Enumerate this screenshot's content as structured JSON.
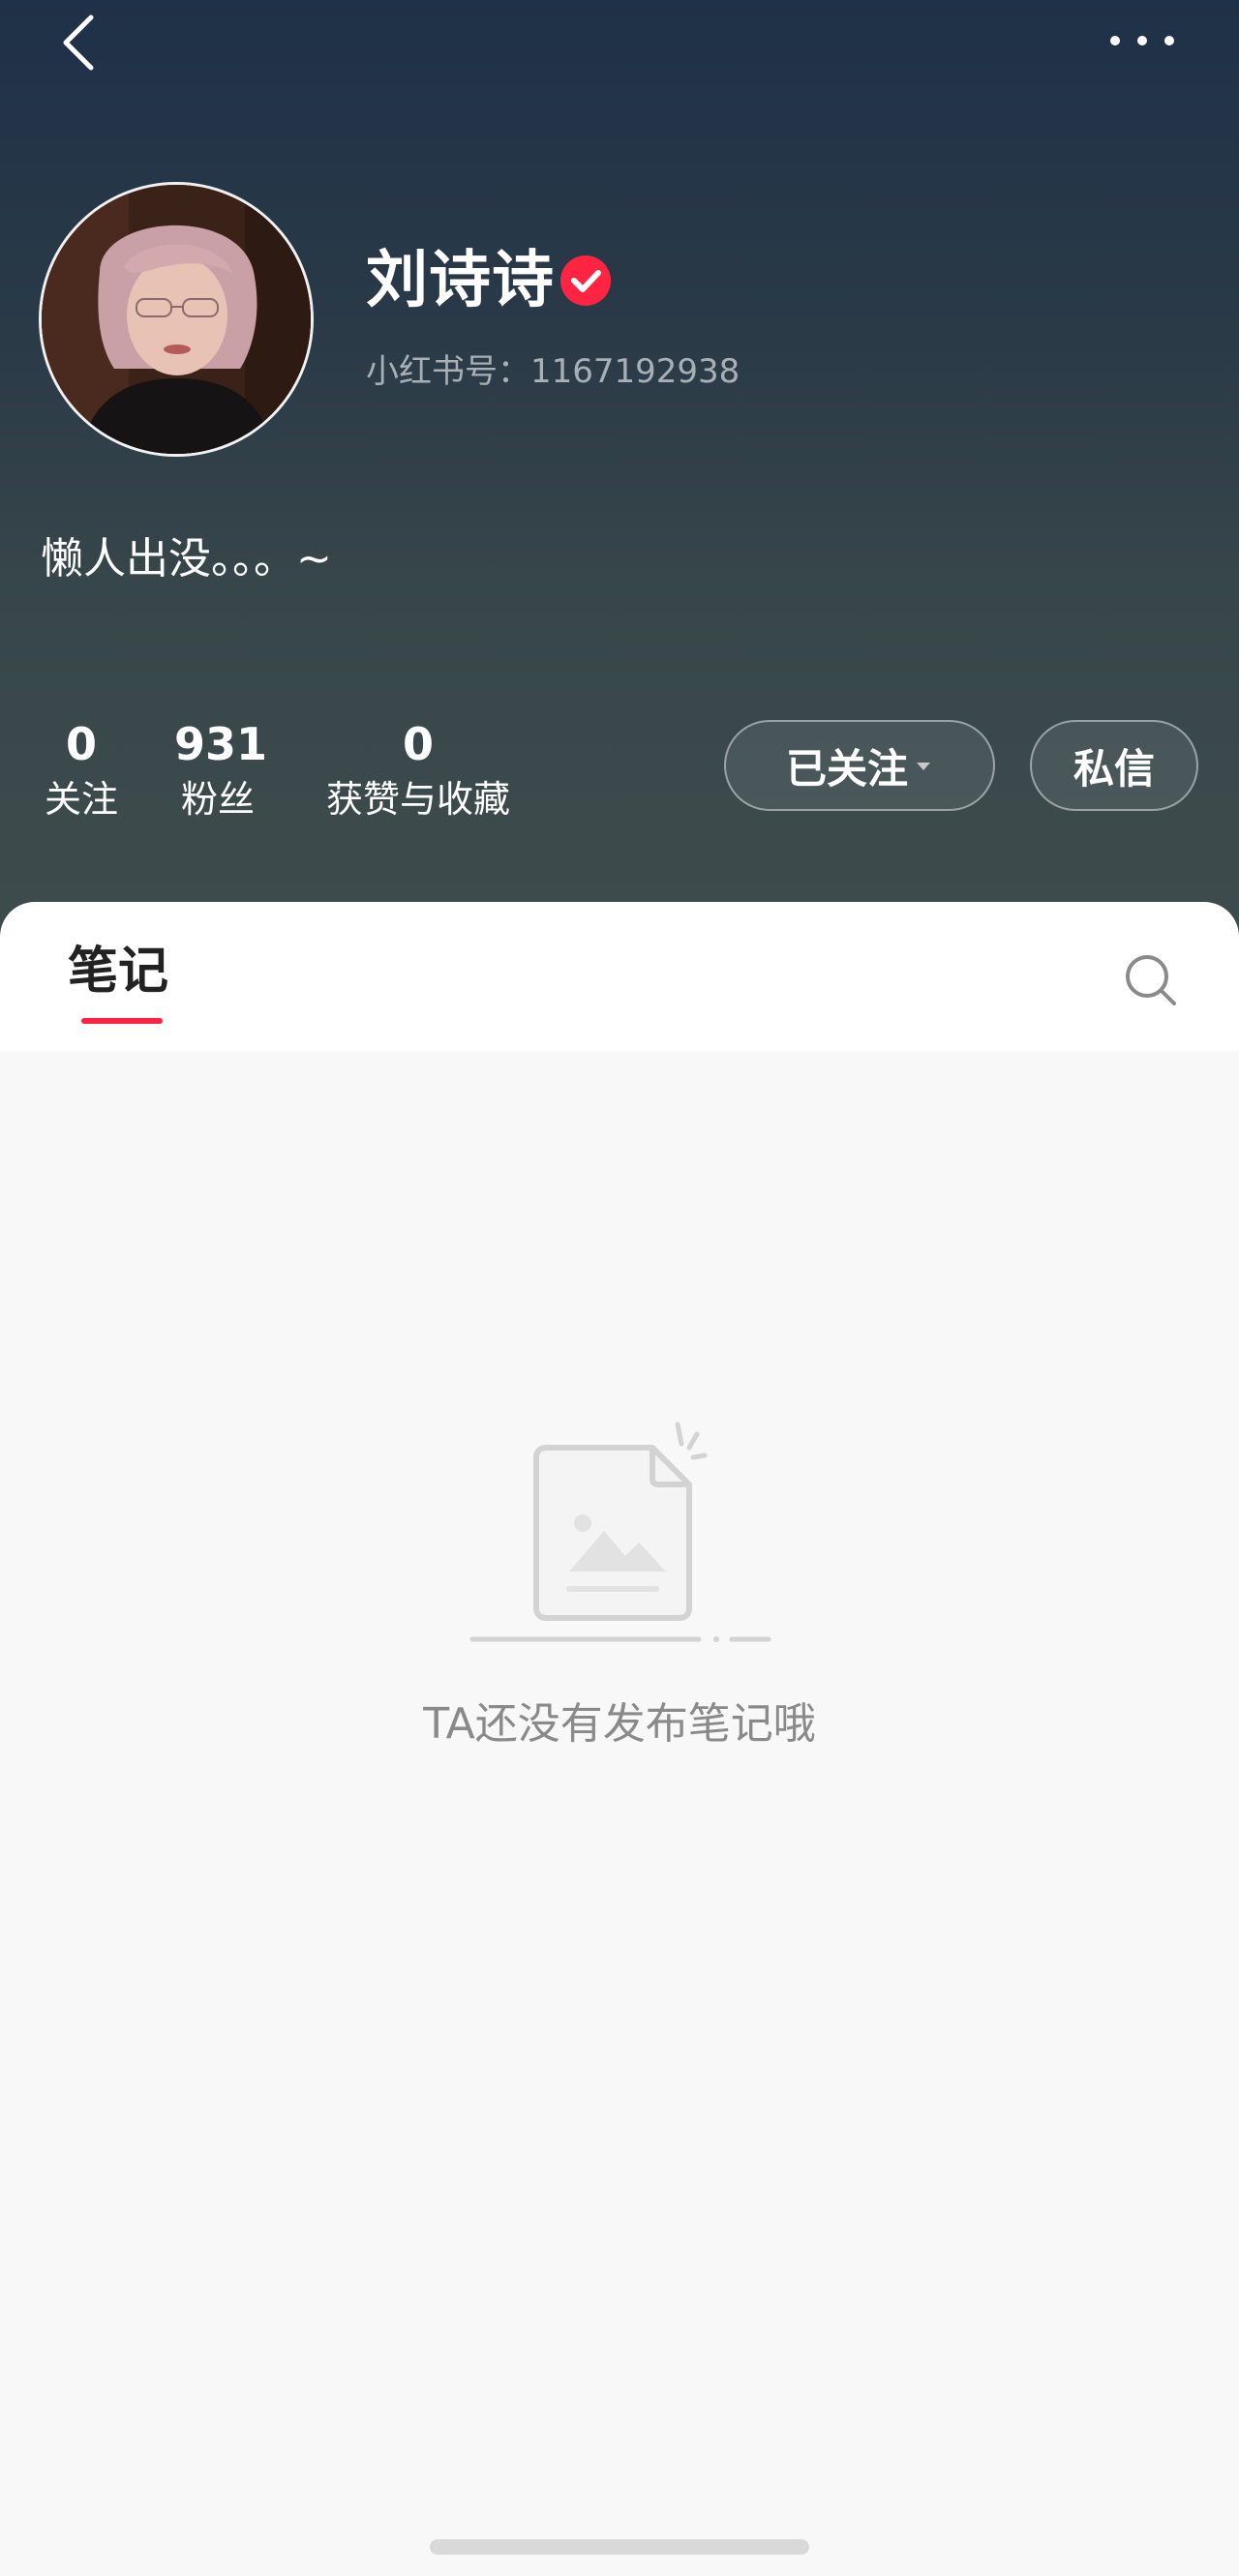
{
  "header": {
    "back_icon": "chevron-left-icon",
    "more_icon": "more-dots-icon"
  },
  "profile": {
    "name": "刘诗诗",
    "verified_icon": "verified-badge-icon",
    "user_id": "小红书号：1167192938",
    "bio": "懒人出没。。。~"
  },
  "stats": [
    {
      "value": "0",
      "label": "关注"
    },
    {
      "value": "931",
      "label": "粉丝"
    },
    {
      "value": "0",
      "label": "获赞与收藏"
    }
  ],
  "actions": {
    "follow_label": "已关注",
    "message_label": "私信"
  },
  "tabs": {
    "notes_label": "笔记",
    "search_icon": "search-icon"
  },
  "empty_state": {
    "icon": "empty-document-icon",
    "text": "TA还没有发布笔记哦"
  },
  "colors": {
    "accent": "#ff2442",
    "header_top": "#1f3148",
    "header_bottom": "#3f4c4d",
    "background": "#f8f8f8"
  }
}
